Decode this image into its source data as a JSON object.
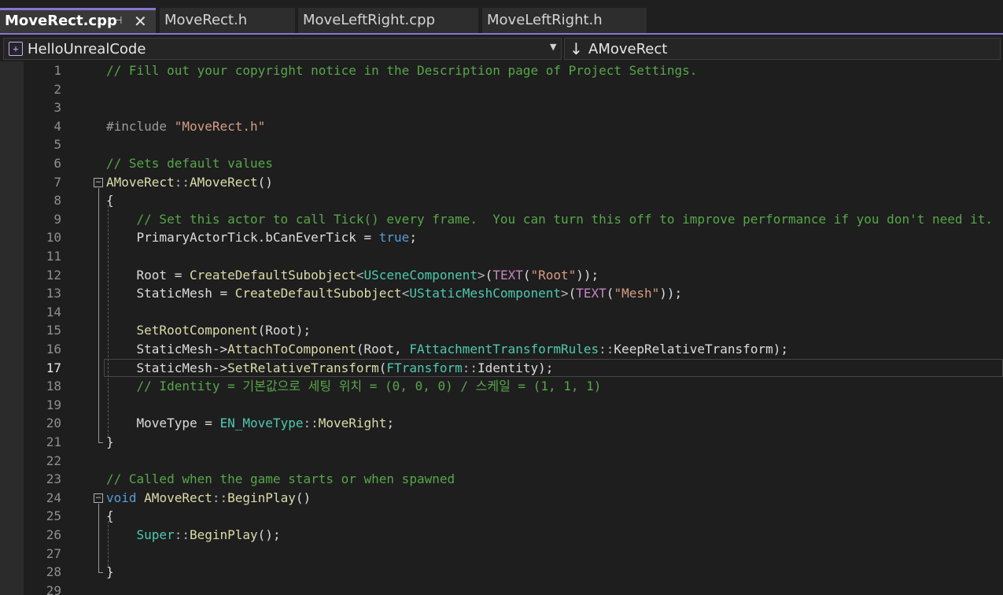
{
  "tabs": [
    {
      "label": "MoveRect.cpp",
      "active": true
    },
    {
      "label": "MoveRect.h",
      "active": false
    },
    {
      "label": "MoveLeftRight.cpp",
      "active": false
    },
    {
      "label": "MoveLeftRight.h",
      "active": false
    }
  ],
  "tab_icons": {
    "pin": "pin-icon",
    "close": "close-icon"
  },
  "navbar": {
    "project": "HelloUnrealCode",
    "scope": "AMoveRect",
    "project_icon": "project-icon",
    "scope_icon": "down-arrow-icon"
  },
  "editor": {
    "current_line": 17,
    "line_numbers": [
      "1",
      "2",
      "3",
      "4",
      "5",
      "6",
      "7",
      "8",
      "9",
      "10",
      "11",
      "12",
      "13",
      "14",
      "15",
      "16",
      "17",
      "18",
      "19",
      "20",
      "21",
      "22",
      "23",
      "24",
      "25",
      "26",
      "27",
      "28",
      "29"
    ],
    "lines": [
      [
        [
          "cm",
          "// Fill out your copyright notice in the Description page of Project Settings."
        ]
      ],
      [],
      [],
      [
        [
          "pp",
          "#include "
        ],
        [
          "st",
          "\"MoveRect.h\""
        ]
      ],
      [],
      [
        [
          "cm",
          "// Sets default values"
        ]
      ],
      [
        [
          "fn",
          "AMoveRect"
        ],
        [
          "op",
          "::"
        ],
        [
          "fn",
          "AMoveRect"
        ],
        [
          "df",
          "()"
        ]
      ],
      [
        [
          "df",
          "{"
        ]
      ],
      [
        [
          "cm",
          "    // Set this actor to call Tick() every frame.  You can turn this off to improve performance if you don't need it."
        ]
      ],
      [
        [
          "df",
          "    PrimaryActorTick.bCanEverTick = "
        ],
        [
          "kw",
          "true"
        ],
        [
          "df",
          ";"
        ]
      ],
      [],
      [
        [
          "df",
          "    Root = "
        ],
        [
          "fn",
          "CreateDefaultSubobject"
        ],
        [
          "op",
          "<"
        ],
        [
          "ty",
          "USceneComponent"
        ],
        [
          "op",
          ">"
        ],
        [
          "df",
          "("
        ],
        [
          "mc",
          "TEXT"
        ],
        [
          "df",
          "("
        ],
        [
          "st",
          "\"Root\""
        ],
        [
          "df",
          "));"
        ]
      ],
      [
        [
          "df",
          "    StaticMesh = "
        ],
        [
          "fn",
          "CreateDefaultSubobject"
        ],
        [
          "op",
          "<"
        ],
        [
          "ty",
          "UStaticMeshComponent"
        ],
        [
          "op",
          ">"
        ],
        [
          "df",
          "("
        ],
        [
          "mc",
          "TEXT"
        ],
        [
          "df",
          "("
        ],
        [
          "st",
          "\"Mesh\""
        ],
        [
          "df",
          "));"
        ]
      ],
      [],
      [
        [
          "df",
          "    "
        ],
        [
          "fn",
          "SetRootComponent"
        ],
        [
          "df",
          "(Root);"
        ]
      ],
      [
        [
          "df",
          "    StaticMesh->"
        ],
        [
          "fn",
          "AttachToComponent"
        ],
        [
          "df",
          "(Root, "
        ],
        [
          "ty",
          "FAttachmentTransformRules"
        ],
        [
          "op",
          "::"
        ],
        [
          "df",
          "KeepRelativeTransform);"
        ]
      ],
      [
        [
          "df",
          "    StaticMesh->"
        ],
        [
          "fn",
          "SetRelativeTransform"
        ],
        [
          "df",
          "("
        ],
        [
          "ty",
          "FTransform"
        ],
        [
          "op",
          "::"
        ],
        [
          "df",
          "Identity);"
        ]
      ],
      [
        [
          "cm",
          "    // Identity = 기본값으로 세팅 위치 = (0, 0, 0) / 스케일 = (1, 1, 1)"
        ]
      ],
      [],
      [
        [
          "df",
          "    MoveType = "
        ],
        [
          "ty",
          "EN_MoveType"
        ],
        [
          "op",
          "::"
        ],
        [
          "fn",
          "MoveRight"
        ],
        [
          "df",
          ";"
        ]
      ],
      [
        [
          "df",
          "}"
        ]
      ],
      [],
      [
        [
          "cm",
          "// Called when the game starts or when spawned"
        ]
      ],
      [
        [
          "kw",
          "void "
        ],
        [
          "fn",
          "AMoveRect"
        ],
        [
          "op",
          "::"
        ],
        [
          "fn",
          "BeginPlay"
        ],
        [
          "df",
          "()"
        ]
      ],
      [
        [
          "df",
          "{"
        ]
      ],
      [
        [
          "df",
          "    "
        ],
        [
          "ty",
          "Super"
        ],
        [
          "op",
          "::"
        ],
        [
          "fn",
          "BeginPlay"
        ],
        [
          "df",
          "();"
        ]
      ],
      [],
      [
        [
          "df",
          "}"
        ]
      ],
      []
    ]
  }
}
